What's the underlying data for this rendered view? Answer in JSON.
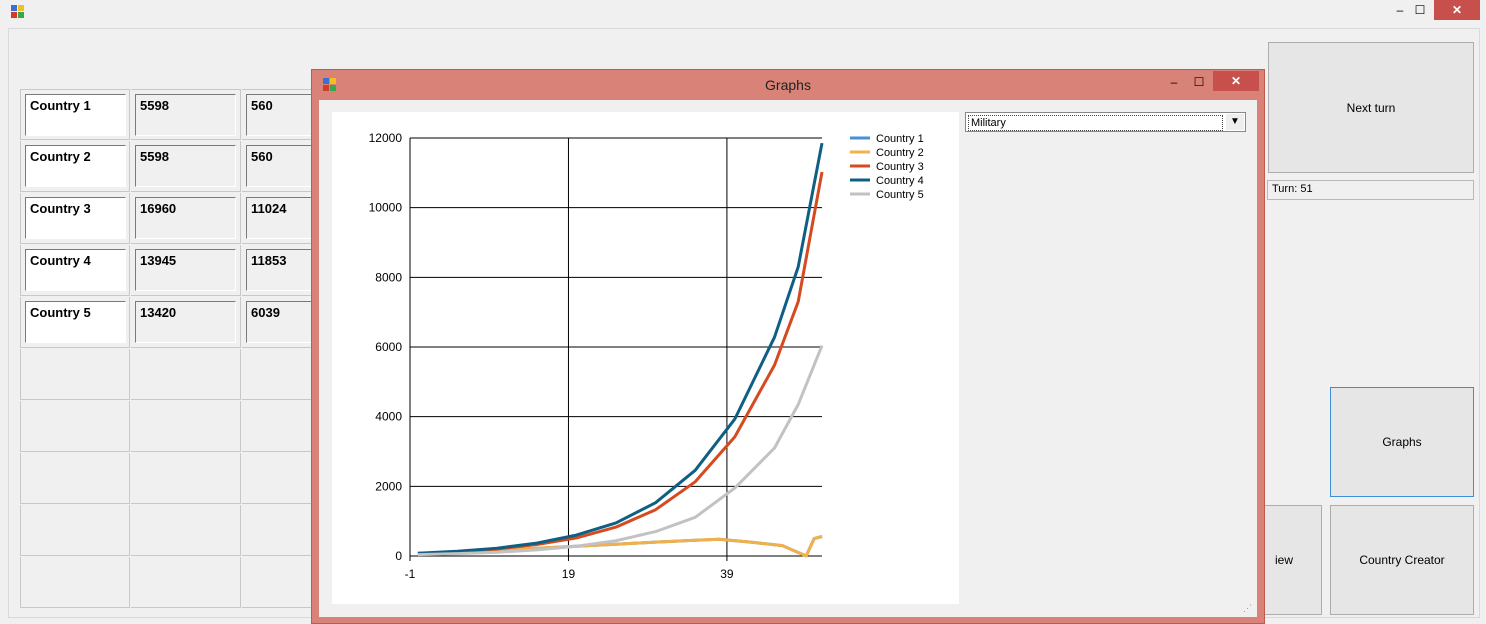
{
  "main_window": {
    "controls": {
      "minimize": "‒",
      "maximize": "☐",
      "close": "✕"
    }
  },
  "grid": {
    "rows": [
      [
        "Country 1",
        "5598",
        "560"
      ],
      [
        "Country 2",
        "5598",
        "560"
      ],
      [
        "Country 3",
        "16960",
        "11024"
      ],
      [
        "Country 4",
        "13945",
        "11853"
      ],
      [
        "Country 5",
        "13420",
        "6039"
      ]
    ],
    "empty_rows": 5
  },
  "buttons": {
    "next_turn": "Next turn",
    "graphs": "Graphs",
    "view": "iew",
    "country_creator": "Country Creator"
  },
  "turn_label": "Turn: 51",
  "graphs_dialog": {
    "title": "Graphs",
    "controls": {
      "minimize": "‒",
      "maximize": "☐",
      "close": "✕"
    },
    "combo": {
      "selected": "Military"
    }
  },
  "colors": {
    "accent_close": "#c7504c",
    "dialog_frame": "#d98277"
  },
  "chart_data": {
    "type": "line",
    "xlim": [
      -1,
      51
    ],
    "ylim": [
      0,
      12000
    ],
    "x_ticks": [
      -1,
      19,
      39
    ],
    "y_ticks": [
      0,
      2000,
      4000,
      6000,
      8000,
      10000,
      12000
    ],
    "grid": true,
    "legend_position": "top-right",
    "series": [
      {
        "name": "Country 1",
        "color": "#4a90d9",
        "points": [
          [
            0,
            80
          ],
          [
            5,
            110
          ],
          [
            10,
            160
          ],
          [
            15,
            220
          ],
          [
            20,
            280
          ],
          [
            25,
            340
          ],
          [
            30,
            400
          ],
          [
            35,
            450
          ],
          [
            38,
            480
          ],
          [
            42,
            400
          ],
          [
            46,
            300
          ],
          [
            49,
            0
          ],
          [
            50,
            500
          ],
          [
            51,
            560
          ]
        ]
      },
      {
        "name": "Country 2",
        "color": "#f0b04a",
        "points": [
          [
            0,
            80
          ],
          [
            5,
            110
          ],
          [
            10,
            160
          ],
          [
            15,
            220
          ],
          [
            20,
            280
          ],
          [
            25,
            340
          ],
          [
            30,
            400
          ],
          [
            35,
            450
          ],
          [
            38,
            480
          ],
          [
            42,
            400
          ],
          [
            46,
            300
          ],
          [
            49,
            0
          ],
          [
            50,
            500
          ],
          [
            51,
            560
          ]
        ]
      },
      {
        "name": "Country 3",
        "color": "#d64a1f",
        "points": [
          [
            0,
            70
          ],
          [
            5,
            120
          ],
          [
            10,
            200
          ],
          [
            15,
            330
          ],
          [
            20,
            520
          ],
          [
            25,
            830
          ],
          [
            30,
            1330
          ],
          [
            35,
            2130
          ],
          [
            40,
            3420
          ],
          [
            45,
            5480
          ],
          [
            48,
            7300
          ],
          [
            51,
            11024
          ]
        ]
      },
      {
        "name": "Country 4",
        "color": "#0f5f85",
        "points": [
          [
            0,
            80
          ],
          [
            5,
            135
          ],
          [
            10,
            225
          ],
          [
            15,
            370
          ],
          [
            20,
            600
          ],
          [
            25,
            950
          ],
          [
            30,
            1530
          ],
          [
            35,
            2460
          ],
          [
            40,
            3930
          ],
          [
            45,
            6280
          ],
          [
            48,
            8300
          ],
          [
            51,
            11853
          ]
        ]
      },
      {
        "name": "Country 5",
        "color": "#c2c2c2",
        "points": [
          [
            0,
            40
          ],
          [
            5,
            70
          ],
          [
            10,
            110
          ],
          [
            15,
            175
          ],
          [
            20,
            280
          ],
          [
            25,
            440
          ],
          [
            30,
            700
          ],
          [
            35,
            1110
          ],
          [
            40,
            1950
          ],
          [
            45,
            3100
          ],
          [
            48,
            4350
          ],
          [
            51,
            6039
          ]
        ]
      }
    ]
  }
}
